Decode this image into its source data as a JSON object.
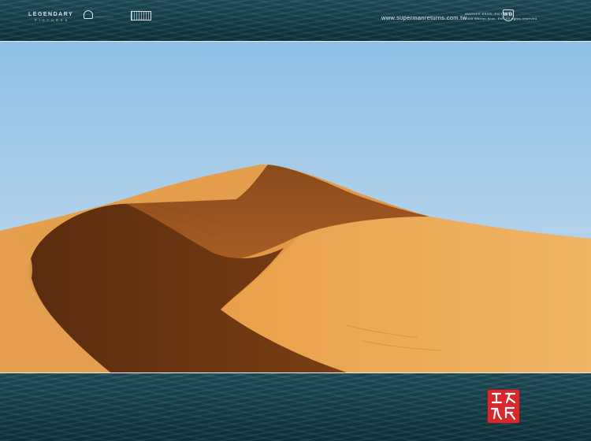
{
  "header": {
    "logo_legendary_title": "LEGENDARY",
    "logo_legendary_sub": "PICTURES",
    "website": "www.supermanreturns.com.tw",
    "wb_text_line1": "WARNER BROS. PICTURES",
    "wb_text_line2": "2006 Warner Bros. Ent. All rights reserved.",
    "wb_shield": "WB"
  },
  "seal": {
    "icon": "red-chinese-seal-stamp",
    "color": "#d8282d"
  },
  "photo": {
    "subject": "desert-sand-dune",
    "sky_color": "#9cc6e6",
    "sand_color": "#e29a44",
    "shadow_color": "#6a3410"
  }
}
